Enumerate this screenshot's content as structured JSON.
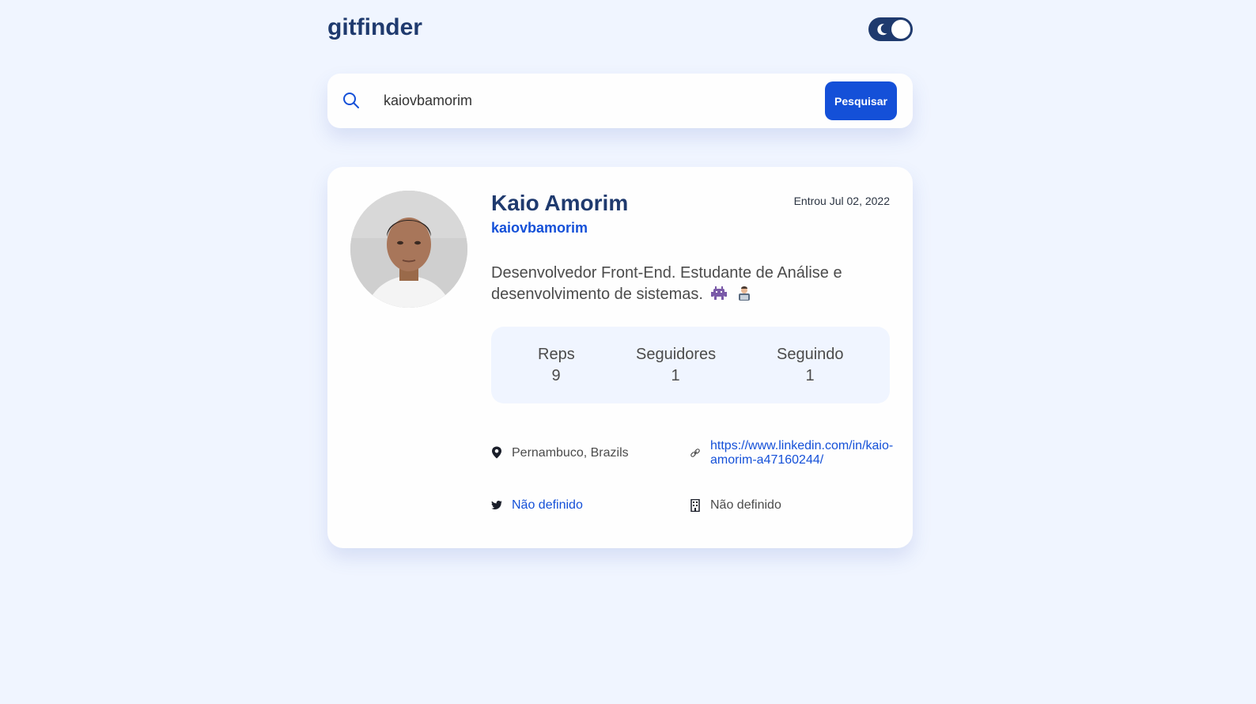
{
  "header": {
    "logo": "gitfinder",
    "theme_toggle_icon": "moon-icon"
  },
  "search": {
    "value": "kaiovbamorim",
    "button_label": "Pesquisar",
    "icon": "search-icon"
  },
  "profile": {
    "name": "Kaio Amorim",
    "login": "kaiovbamorim",
    "joined": "Entrou Jul 02, 2022",
    "bio": "Desenvolvedor Front-End. Estudante de Análise e desenvolvimento de sistemas.",
    "bio_emojis": [
      "alien-monster-emoji",
      "technologist-emoji"
    ],
    "stats": [
      {
        "label": "Reps",
        "value": "9"
      },
      {
        "label": "Seguidores",
        "value": "1"
      },
      {
        "label": "Seguindo",
        "value": "1"
      }
    ],
    "location": "Pernambuco, Brazils",
    "blog": "https://www.linkedin.com/in/kaio-amorim-a47160244/",
    "twitter": "Não definido",
    "company": "Não definido"
  },
  "colors": {
    "background": "#f0f5ff",
    "accent": "#1450d8",
    "heading": "#1f3a6e",
    "card": "#fefefe"
  }
}
